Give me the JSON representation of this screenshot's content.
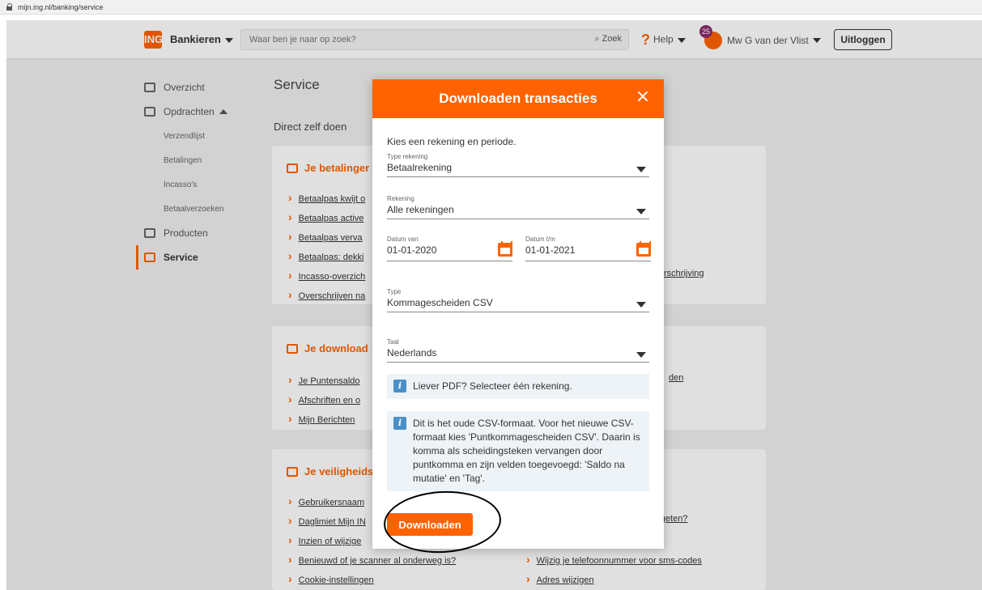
{
  "browser": {
    "url": "mijn.ing.nl/banking/service"
  },
  "header": {
    "logo_text": "ING",
    "menu_label": "Bankieren",
    "search_placeholder": "Waar ben je naar op zoek?",
    "search_button": "Zoek",
    "help_label": "Help",
    "notification_count": "25",
    "user_name": "Mw G van der Vlist",
    "logout_label": "Uitloggen"
  },
  "sidebar": {
    "items": [
      {
        "label": "Overzicht"
      },
      {
        "label": "Opdrachten"
      },
      {
        "label": "Verzendlijst"
      },
      {
        "label": "Betalingen"
      },
      {
        "label": "Incasso's"
      },
      {
        "label": "Betaalverzoeken"
      },
      {
        "label": "Producten"
      },
      {
        "label": "Service"
      }
    ]
  },
  "main": {
    "title": "Service",
    "section_title": "Direct zelf doen",
    "cards": [
      {
        "title": "Je betalinger",
        "links_left": [
          "Betaalpas kwijt o",
          "Betaalpas active",
          "Betaalpas verva",
          "Betaalpas: dekki",
          "Incasso-overzich",
          "Overschrijven na"
        ],
        "links_right": [
          "rschrijving"
        ]
      },
      {
        "title": "Je download",
        "links_left": [
          "Je Puntensaldo",
          "Afschriften en o",
          "Mijn Berichten"
        ],
        "links_right": [
          "den"
        ]
      },
      {
        "title": "Je veiligheids",
        "links_left": [
          "Gebruikersnaam",
          "Daglimiet Mijn IN",
          "Inzien of wijzige",
          "Benieuwd of je scanner al onderweg is?",
          "Cookie-instellingen"
        ],
        "links_right": [
          "ergeten?",
          "Wijzig je telefoonnummer voor sms-codes",
          "Adres wijzigen"
        ]
      }
    ]
  },
  "modal": {
    "title": "Downloaden transacties",
    "close_label": "×",
    "intro": "Kies een rekening en periode.",
    "type_rekening": {
      "label": "Type rekening",
      "value": "Betaalrekening"
    },
    "rekening": {
      "label": "Rekening",
      "value": "Alle rekeningen"
    },
    "datum_van": {
      "label": "Datum van",
      "value": "01-01-2020"
    },
    "datum_tm": {
      "label": "Datum t/m",
      "value": "01-01-2021"
    },
    "type": {
      "label": "Type",
      "value": "Kommagescheiden CSV"
    },
    "taal": {
      "label": "Taal",
      "value": "Nederlands"
    },
    "info_pdf": "Liever PDF? Selecteer één rekening.",
    "info_csv": "Dit is het oude CSV-formaat. Voor het nieuwe CSV-formaat kies 'Puntkommagescheiden CSV'. Daarin is komma als scheidingsteken vervangen door puntkomma en zijn velden toegevoegd: 'Saldo na mutatie' en 'Tag'.",
    "download_button": "Downloaden",
    "info_icon_glyph": "i"
  },
  "colors": {
    "brand": "#ff6200",
    "info_bg": "#eef3f7",
    "info_icon": "#4a90c8"
  }
}
